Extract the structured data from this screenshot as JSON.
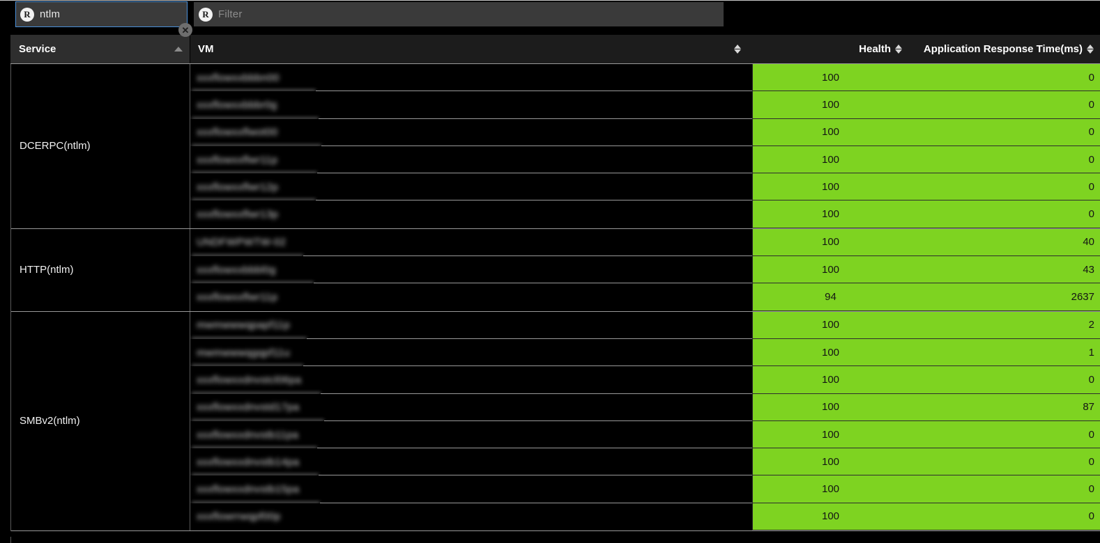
{
  "filter_bar": {
    "search": {
      "icon": "regex-icon",
      "icon_label": "R",
      "value": "ntlm",
      "placeholder": "Filter",
      "clear_label": "✕"
    },
    "filter": {
      "icon": "regex-icon",
      "icon_label": "R",
      "value": "",
      "placeholder": "Filter"
    }
  },
  "colors": {
    "health_green": "#7ed321",
    "focus_border": "#4a90d9",
    "header_bg": "#1c1c1c",
    "service_header_bg": "#2e2e2e"
  },
  "table": {
    "columns": [
      {
        "key": "service",
        "label": "Service",
        "sort": "asc"
      },
      {
        "key": "vm",
        "label": "VM",
        "sort": "none"
      },
      {
        "key": "health",
        "label": "Health",
        "sort": "none"
      },
      {
        "key": "art",
        "label": "Application Response Time(ms)",
        "sort": "none"
      }
    ],
    "groups": [
      {
        "service": "DCERPC(ntlm)",
        "rows": [
          {
            "vm": "xxxflowxxbbbn00",
            "health": "100",
            "art": "0"
          },
          {
            "vm": "xxxflowxxbbbr0g",
            "health": "100",
            "art": "0"
          },
          {
            "vm": "xxxflowxxflwot00",
            "health": "100",
            "art": "0"
          },
          {
            "vm": "xxxflowxxflwr11p",
            "health": "100",
            "art": "0"
          },
          {
            "vm": "xxxflowxxflwr12p",
            "health": "100",
            "art": "0"
          },
          {
            "vm": "xxxflowxxflwr13p",
            "health": "100",
            "art": "0"
          }
        ]
      },
      {
        "service": "HTTP(ntlm)",
        "rows": [
          {
            "vm": "UNDFWPWTW-02",
            "health": "100",
            "art": "40"
          },
          {
            "vm": "xxxflowxxbbbl0g",
            "health": "100",
            "art": "43"
          },
          {
            "vm": "xxxflowxxflwr11p",
            "health": "94",
            "art": "2637"
          }
        ]
      },
      {
        "service": "SMBv2(ntlm)",
        "rows": [
          {
            "vm": "mwmwwwqpapf11p",
            "health": "100",
            "art": "2"
          },
          {
            "vm": "mwmwwwqgqpf11u",
            "health": "100",
            "art": "1"
          },
          {
            "vm": "xxxflowxxdnvstcl06pa",
            "health": "100",
            "art": "0"
          },
          {
            "vm": "xxxflowxxdnvstd17pa",
            "health": "100",
            "art": "87"
          },
          {
            "vm": "xxxflowxxdnvstb11pa",
            "health": "100",
            "art": "0"
          },
          {
            "vm": "xxxflowxxdnvstb14pa",
            "health": "100",
            "art": "0"
          },
          {
            "vm": "xxxflowxxdnvstb15pa",
            "health": "100",
            "art": "0"
          },
          {
            "vm": "xxxflowrrwqpf00p",
            "health": "100",
            "art": "0"
          }
        ]
      }
    ]
  }
}
